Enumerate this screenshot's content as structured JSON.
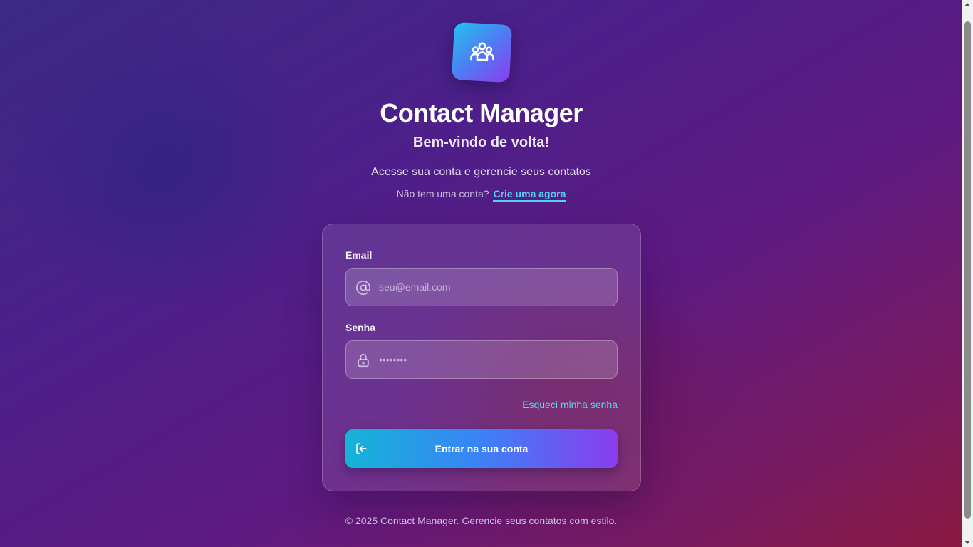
{
  "header": {
    "logo_icon": "users-group-icon",
    "title": "Contact Manager",
    "subtitle": "Bem-vindo de volta!",
    "tagline": "Acesse sua conta e gerencie seus contatos",
    "signup_prompt": "Não tem uma conta?",
    "signup_link": "Crie uma agora"
  },
  "form": {
    "email": {
      "label": "Email",
      "icon": "at-sign-icon",
      "placeholder": "seu@email.com",
      "value": ""
    },
    "password": {
      "label": "Senha",
      "icon": "lock-icon",
      "placeholder": "••••••••",
      "value": ""
    },
    "forgot_link": "Esqueci minha senha",
    "submit_label": "Entrar na sua conta",
    "submit_icon": "login-icon"
  },
  "footer": {
    "text": "© 2025 Contact Manager. Gerencie seus contatos com estilo."
  },
  "colors": {
    "accent_link": "#4fd3f0",
    "button_gradient_start": "#14b4d8",
    "button_gradient_end": "#8b3cf0",
    "background_start": "#3b2a86",
    "background_end": "#8a1a40"
  }
}
